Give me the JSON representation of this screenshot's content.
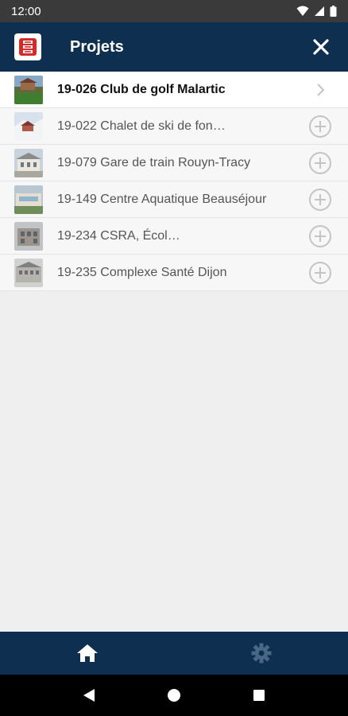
{
  "status_bar": {
    "time": "12:00"
  },
  "app_bar": {
    "title": "Projets",
    "logo_icon": "app-logo-icon",
    "close_icon": "close-icon"
  },
  "projects": [
    {
      "label": "19-026 Club de golf Malartic",
      "active": true,
      "action_icon": "chevron-right-icon"
    },
    {
      "label": "19-022 Chalet de ski de fon…",
      "active": false,
      "action_icon": "add-circle-icon"
    },
    {
      "label": "19-079 Gare de train Rouyn-Tracy",
      "active": false,
      "action_icon": "add-circle-icon"
    },
    {
      "label": "19-149 Centre Aquatique Beauséjour",
      "active": false,
      "action_icon": "add-circle-icon"
    },
    {
      "label": "19-234 CSRA, Écol…",
      "active": false,
      "action_icon": "add-circle-icon"
    },
    {
      "label": "19-235 Complexe Santé Dijon",
      "active": false,
      "action_icon": "add-circle-icon"
    }
  ],
  "bottom_nav": {
    "home_icon": "home-icon",
    "settings_icon": "gear-icon"
  },
  "colors": {
    "primary": "#0e2f4f",
    "status_bar": "#3a3a3a",
    "list_bg": "#f7f7f7",
    "active_row": "#ffffff"
  }
}
